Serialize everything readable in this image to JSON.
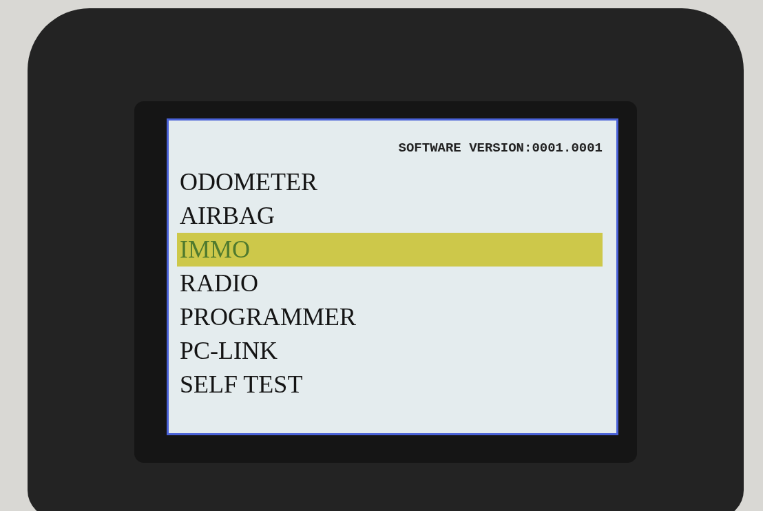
{
  "screen": {
    "header": "SOFTWARE VERSION:0001.0001",
    "menu": [
      {
        "label": "ODOMETER",
        "selected": false
      },
      {
        "label": "AIRBAG",
        "selected": false
      },
      {
        "label": "IMMO",
        "selected": true
      },
      {
        "label": "RADIO",
        "selected": false
      },
      {
        "label": "PROGRAMMER",
        "selected": false
      },
      {
        "label": "PC-LINK",
        "selected": false
      },
      {
        "label": "SELF TEST",
        "selected": false
      }
    ]
  }
}
